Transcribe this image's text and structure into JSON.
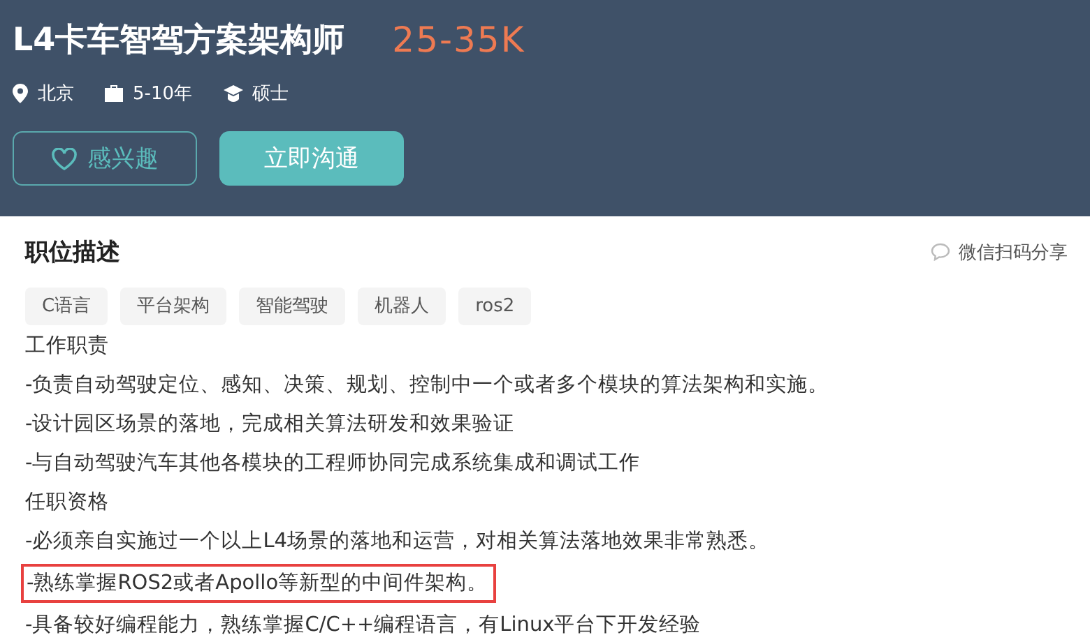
{
  "job": {
    "title": "L4卡车智驾方案架构师",
    "salary": "25-35K",
    "meta": [
      {
        "kind": "location",
        "text": "北京"
      },
      {
        "kind": "experience",
        "text": "5-10年"
      },
      {
        "kind": "degree",
        "text": "硕士"
      }
    ],
    "buttons": [
      {
        "kind": "interest",
        "label": "感兴趣"
      },
      {
        "kind": "chat",
        "label": "立即沟通"
      }
    ]
  },
  "description": {
    "heading": "职位描述",
    "share": "微信扫码分享",
    "tags": [
      "C语言",
      "平台架构",
      "智能驾驶",
      "机器人",
      "ros2"
    ],
    "lines": [
      {
        "text": "工作职责",
        "highlighted": false
      },
      {
        "text": "-负责自动驾驶定位、感知、决策、规划、控制中一个或者多个模块的算法架构和实施。",
        "highlighted": false
      },
      {
        "text": "-设计园区场景的落地，完成相关算法研发和效果验证",
        "highlighted": false
      },
      {
        "text": "-与自动驾驶汽车其他各模块的工程师协同完成系统集成和调试工作",
        "highlighted": false
      },
      {
        "text": "任职资格",
        "highlighted": false
      },
      {
        "text": "-必须亲自实施过一个以上L4场景的落地和运营，对相关算法落地效果非常熟悉。",
        "highlighted": false
      },
      {
        "text": "-熟练掌握ROS2或者Apollo等新型的中间件架构。",
        "highlighted": true
      },
      {
        "text": "-具备较好编程能力，熟练掌握C/C++编程语言，有Linux平台下开发经验",
        "highlighted": false
      }
    ]
  }
}
